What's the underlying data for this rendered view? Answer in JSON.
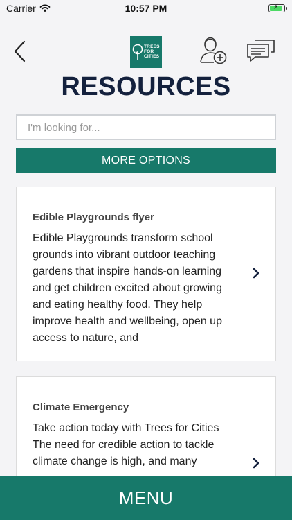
{
  "status_bar": {
    "carrier": "Carrier",
    "time": "10:57 PM"
  },
  "header": {
    "logo_text": [
      "TREES",
      "FOR",
      "CITIES"
    ],
    "title": "RESOURCES"
  },
  "search": {
    "placeholder": "I'm looking for...",
    "value": ""
  },
  "more_options_label": "MORE OPTIONS",
  "cards": [
    {
      "title": "Edible Playgrounds flyer",
      "description": "Edible Playgrounds transform school grounds into vibrant outdoor teaching gardens that inspire hands-on learning and get children excited about growing and eating healthy food. They help improve health and wellbeing, open up access to nature, and"
    },
    {
      "title": "Climate Emergency",
      "description": "Take action today with Trees for Cities The need for credible action to tackle climate change is high, and many"
    }
  ],
  "menu_label": "MENU",
  "colors": {
    "brand_green": "#17796a",
    "title_navy": "#14213d",
    "background": "#f4f4f6"
  },
  "icons": {
    "back": "chevron-left-icon",
    "add_user": "add-user-icon",
    "messages": "chat-bubbles-icon",
    "card_arrow": "chevron-right-icon"
  }
}
